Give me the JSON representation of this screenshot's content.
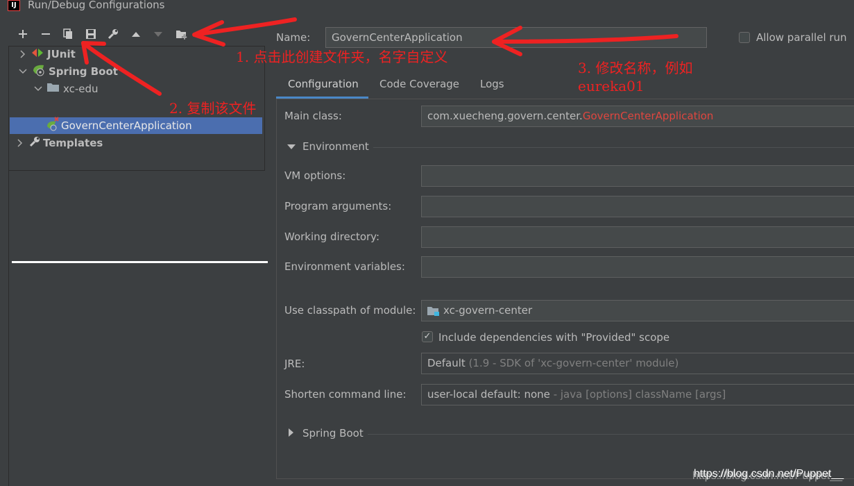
{
  "window": {
    "title": "Run/Debug Configurations",
    "app_icon_text": "IJ"
  },
  "toolbar": {
    "buttons": [
      "add",
      "remove",
      "copy",
      "save",
      "edit-defaults",
      "move-up",
      "move-down",
      "new-folder"
    ]
  },
  "tree": {
    "junit": "JUnit",
    "spring_boot": "Spring Boot",
    "folder": "xc-edu",
    "config": "GovernCenterApplication",
    "templates": "Templates"
  },
  "name_field": {
    "label": "Name:",
    "value": "GovernCenterApplication"
  },
  "parallel": {
    "label": "Allow parallel run"
  },
  "tabs": [
    "Configuration",
    "Code Coverage",
    "Logs"
  ],
  "config": {
    "main_class_label": "Main class:",
    "main_class_pkg": "com.xuecheng.govern.center.",
    "main_class_name": "GovernCenterApplication",
    "environment_section": "Environment",
    "vm_options_label": "VM options:",
    "program_args_label": "Program arguments:",
    "working_dir_label": "Working directory:",
    "env_vars_label": "Environment variables:",
    "classpath_label": "Use classpath of module:",
    "classpath_value": "xc-govern-center",
    "include_deps_label": "Include dependencies with \"Provided\" scope",
    "jre_label": "JRE:",
    "jre_value": "Default",
    "jre_detail": " (1.9 - SDK of 'xc-govern-center' module)",
    "shorten_label": "Shorten command line:",
    "shorten_value": "user-local default: none",
    "shorten_detail": " - java [options] className [args]",
    "spring_boot_section": "Spring Boot"
  },
  "annotations": {
    "a1": "1. 点击此创建文件夹，名字自定义",
    "a2": "2. 复制该文件",
    "a3_line1": "3. 修改名称，例如",
    "a3_line2": "eureka01",
    "color": "#ee2222"
  },
  "watermark": "https://blog.csdn.net/Puppet__"
}
